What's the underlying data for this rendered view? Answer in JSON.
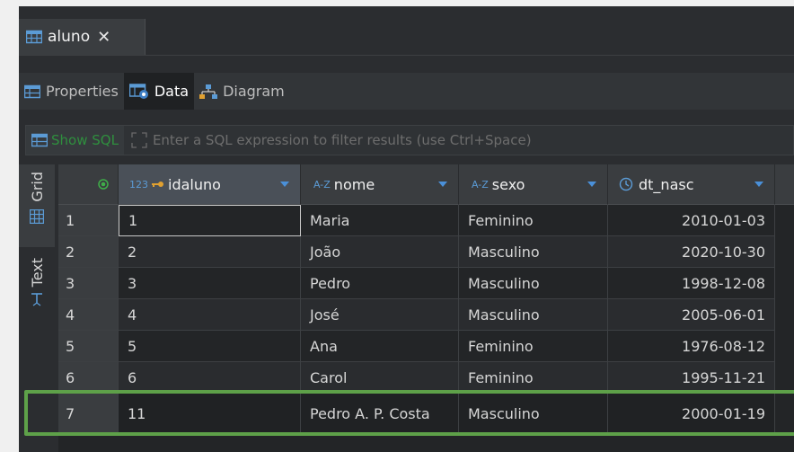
{
  "editor_tab": {
    "label": "aluno",
    "close": "✕"
  },
  "subtabs": [
    {
      "label": "Properties"
    },
    {
      "label": "Data"
    },
    {
      "label": "Diagram"
    }
  ],
  "filter": {
    "show_sql_label": "Show SQL",
    "placeholder": "Enter a SQL expression to filter results (use Ctrl+Space)"
  },
  "side_tabs": {
    "grid": "Grid",
    "text": "Text"
  },
  "columns": [
    {
      "type_badge": "123",
      "name": "idaluno"
    },
    {
      "type_badge": "A-Z",
      "name": "nome"
    },
    {
      "type_badge": "A-Z",
      "name": "sexo"
    },
    {
      "type_badge": "",
      "name": "dt_nasc"
    }
  ],
  "rows": [
    {
      "n": "1",
      "idaluno": "1",
      "nome": "Maria",
      "sexo": "Feminino",
      "dt_nasc": "2010-01-03"
    },
    {
      "n": "2",
      "idaluno": "2",
      "nome": "João",
      "sexo": "Masculino",
      "dt_nasc": "2020-10-30"
    },
    {
      "n": "3",
      "idaluno": "3",
      "nome": "Pedro",
      "sexo": "Masculino",
      "dt_nasc": "1998-12-08"
    },
    {
      "n": "4",
      "idaluno": "4",
      "nome": "José",
      "sexo": "Masculino",
      "dt_nasc": "2005-06-01"
    },
    {
      "n": "5",
      "idaluno": "5",
      "nome": "Ana",
      "sexo": "Feminino",
      "dt_nasc": "1976-08-12"
    },
    {
      "n": "6",
      "idaluno": "6",
      "nome": "Carol",
      "sexo": "Feminino",
      "dt_nasc": "1995-11-21"
    },
    {
      "n": "7",
      "idaluno": "11",
      "nome": "Pedro A. P. Costa",
      "sexo": "Masculino",
      "dt_nasc": "2000-01-19"
    }
  ],
  "colors": {
    "accent_green": "#5ea149",
    "type_blue": "#5b9bd5",
    "show_sql_green": "#2f8f3e"
  }
}
